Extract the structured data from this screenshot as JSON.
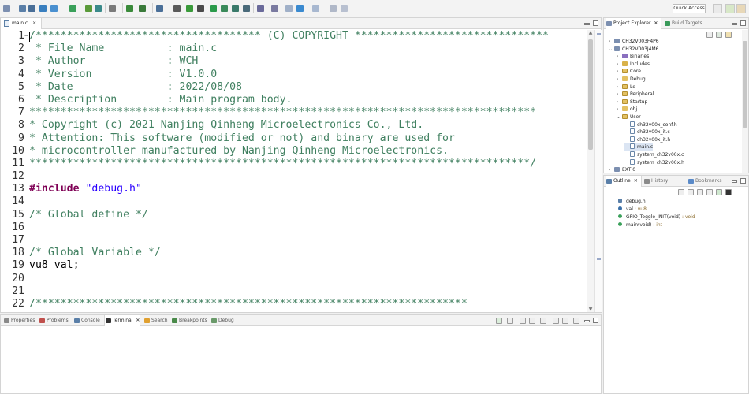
{
  "toolbar": {
    "quick_access": "Quick Access"
  },
  "editor": {
    "tab_label": "main.c",
    "tab_close": "✕",
    "lines": [
      {
        "n": "1",
        "segments": [
          {
            "cls": "c-comment",
            "t": "/************************************ (C) COPYRIGHT *******************************"
          }
        ]
      },
      {
        "n": "2",
        "segments": [
          {
            "cls": "c-comment",
            "t": " * File Name          : main.c"
          }
        ]
      },
      {
        "n": "3",
        "segments": [
          {
            "cls": "c-comment",
            "t": " * Author             : WCH"
          }
        ]
      },
      {
        "n": "4",
        "segments": [
          {
            "cls": "c-comment",
            "t": " * Version            : V1.0.0"
          }
        ]
      },
      {
        "n": "5",
        "segments": [
          {
            "cls": "c-comment",
            "t": " * Date               : 2022/08/08"
          }
        ]
      },
      {
        "n": "6",
        "segments": [
          {
            "cls": "c-comment",
            "t": " * Description        : Main program body."
          }
        ]
      },
      {
        "n": "7",
        "segments": [
          {
            "cls": "c-comment",
            "t": "*********************************************************************************"
          }
        ]
      },
      {
        "n": "8",
        "segments": [
          {
            "cls": "c-comment",
            "t": "* Copyright (c) 2021 Nanjing Qinheng Microelectronics Co., Ltd."
          }
        ]
      },
      {
        "n": "9",
        "segments": [
          {
            "cls": "c-comment",
            "t": "* Attention: This software (modified or not) and binary are used for"
          }
        ]
      },
      {
        "n": "10",
        "segments": [
          {
            "cls": "c-comment",
            "t": "* microcontroller manufactured by Nanjing Qinheng Microelectronics."
          }
        ]
      },
      {
        "n": "11",
        "segments": [
          {
            "cls": "c-comment",
            "t": "********************************************************************************/"
          }
        ]
      },
      {
        "n": "12",
        "segments": []
      },
      {
        "n": "13",
        "segments": [
          {
            "cls": "c-kw",
            "t": "#include"
          },
          {
            "cls": "c-plain",
            "t": " "
          },
          {
            "cls": "c-str",
            "t": "\"debug.h\""
          }
        ]
      },
      {
        "n": "14",
        "segments": []
      },
      {
        "n": "15",
        "segments": [
          {
            "cls": "c-comment",
            "t": "/* Global define */"
          }
        ]
      },
      {
        "n": "16",
        "segments": []
      },
      {
        "n": "17",
        "segments": []
      },
      {
        "n": "18",
        "segments": [
          {
            "cls": "c-comment",
            "t": "/* Global Variable */"
          }
        ]
      },
      {
        "n": "19",
        "segments": [
          {
            "cls": "c-plain",
            "t": "vu8 val;"
          }
        ]
      },
      {
        "n": "20",
        "segments": []
      },
      {
        "n": "21",
        "segments": []
      },
      {
        "n": "22",
        "segments": [
          {
            "cls": "c-comment",
            "t": "/*********************************************************************"
          }
        ]
      }
    ]
  },
  "bottom_panel": {
    "tabs": [
      {
        "label": "Properties",
        "color": "#8a8a8a"
      },
      {
        "label": "Problems",
        "color": "#c0504d"
      },
      {
        "label": "Console",
        "color": "#5a7fa8"
      },
      {
        "label": "Terminal",
        "color": "#333333",
        "active": true
      },
      {
        "label": "Search",
        "color": "#e0a030"
      },
      {
        "label": "Breakpoints",
        "color": "#4a8a4a"
      },
      {
        "label": "Debug",
        "color": "#6a9a6a"
      }
    ]
  },
  "explorer": {
    "tabs": [
      {
        "label": "Project Explorer",
        "active": true
      },
      {
        "label": "Build Targets",
        "active": false
      }
    ],
    "tree": [
      {
        "indent": 0,
        "chev": "›",
        "icon": "proj",
        "label": "CH32V003F4P6"
      },
      {
        "indent": 0,
        "chev": "⌄",
        "icon": "proj",
        "label": "CH32V003J4M6"
      },
      {
        "indent": 1,
        "chev": "›",
        "icon": "bin",
        "label": "Binaries"
      },
      {
        "indent": 1,
        "chev": "›",
        "icon": "inc",
        "label": "Includes"
      },
      {
        "indent": 1,
        "chev": "›",
        "icon": "src",
        "label": "Core"
      },
      {
        "indent": 1,
        "chev": "›",
        "icon": "fold",
        "label": "Debug"
      },
      {
        "indent": 1,
        "chev": "›",
        "icon": "src",
        "label": "Ld"
      },
      {
        "indent": 1,
        "chev": "›",
        "icon": "src",
        "label": "Peripheral"
      },
      {
        "indent": 1,
        "chev": "›",
        "icon": "src",
        "label": "Startup"
      },
      {
        "indent": 1,
        "chev": "›",
        "icon": "fold",
        "label": "obj"
      },
      {
        "indent": 1,
        "chev": "⌄",
        "icon": "src",
        "label": "User"
      },
      {
        "indent": 2,
        "chev": "",
        "icon": "file",
        "label": "ch32v00x_conf.h"
      },
      {
        "indent": 2,
        "chev": "",
        "icon": "file",
        "label": "ch32v00x_it.c"
      },
      {
        "indent": 2,
        "chev": "",
        "icon": "file",
        "label": "ch32v00x_it.h"
      },
      {
        "indent": 2,
        "chev": "",
        "icon": "file",
        "label": "main.c",
        "selected": true
      },
      {
        "indent": 2,
        "chev": "",
        "icon": "file",
        "label": "system_ch32v00x.c"
      },
      {
        "indent": 2,
        "chev": "",
        "icon": "file",
        "label": "system_ch32v00x.h"
      },
      {
        "indent": 0,
        "chev": "›",
        "icon": "proj",
        "label": "EXTI0"
      }
    ]
  },
  "outline": {
    "tabs": [
      {
        "label": "Outline",
        "active": true
      },
      {
        "label": "History",
        "active": false
      },
      {
        "label": "Bookmarks",
        "active": false
      }
    ],
    "items": [
      {
        "name": "debug.h",
        "type": "",
        "color": "#5a7fa8"
      },
      {
        "name": "val",
        "type": " : vu8",
        "color": "#3a6fa8"
      },
      {
        "name": "GPIO_Toggle_INIT(void)",
        "type": " : void",
        "color": "#3aa05a"
      },
      {
        "name": "main(void)",
        "type": " : int",
        "color": "#3aa05a"
      }
    ]
  }
}
